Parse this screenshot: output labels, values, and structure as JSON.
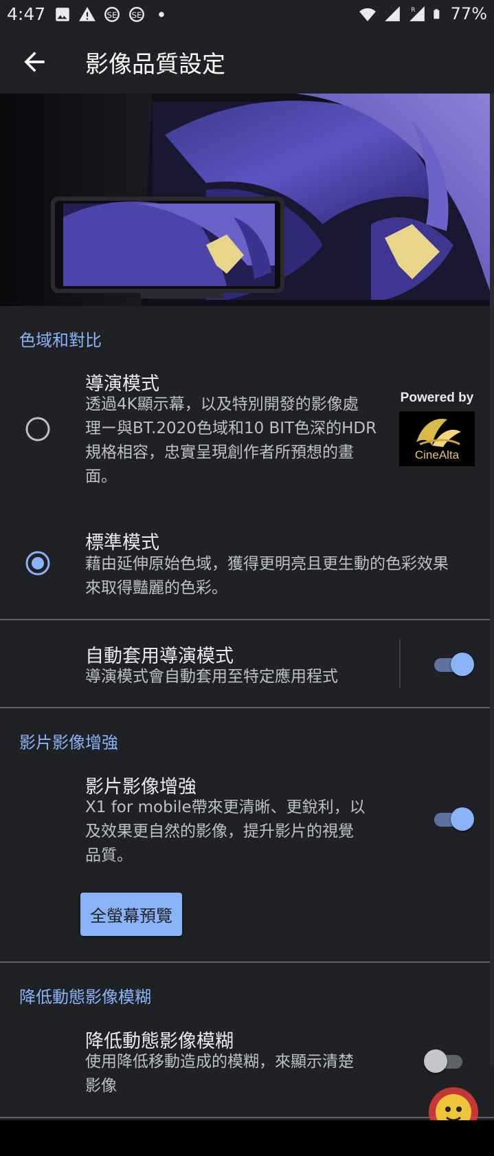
{
  "status_bar": {
    "time": "4:47",
    "battery": "77%",
    "left_icons": [
      "image-icon",
      "alert-icon",
      "sync-icon",
      "sync-icon",
      "dot-icon"
    ],
    "right_icons": [
      "wifi-icon",
      "signal-icon",
      "signal-roaming-icon",
      "battery-icon"
    ]
  },
  "app_bar": {
    "title": "影像品質設定",
    "back_icon": "arrow-back-icon"
  },
  "sections": {
    "color": {
      "header": "色域和對比",
      "director_mode": {
        "title": "導演模式",
        "desc_lines": [
          "透過4K顯示幕，以及特別開發的影像處",
          "理ー與BT.2020色域和10 BIT色深的HDR",
          "規格相容，忠實呈現創作者所預想的畫",
          "面。"
        ],
        "selected": false,
        "badge_top": "Powered by",
        "badge_logo": "CineAlta"
      },
      "standard_mode": {
        "title": "標準模式",
        "desc_lines": [
          "藉由延伸原始色域，獲得更明亮且更生動的色彩效果",
          "來取得豔麗的色彩。"
        ],
        "selected": true
      },
      "auto_director": {
        "title": "自動套用導演模式",
        "desc": "導演模式會自動套用至特定應用程式",
        "enabled": true
      }
    },
    "video_enhance": {
      "header": "影片影像增強",
      "title": "影片影像增強",
      "desc_lines": [
        "X1 for mobile帶來更清晰、更銳利，以",
        "及效果更自然的影像，提升影片的視覺",
        "品質。"
      ],
      "enabled": true,
      "preview_button": "全螢幕預覽"
    },
    "motion_blur": {
      "header": "降低動態影像模糊",
      "title": "降低動態影像模糊",
      "desc_lines": [
        "使用降低移動造成的模糊，來顯示清楚",
        "影像"
      ],
      "enabled": false
    }
  },
  "colors": {
    "accent": "#8ab4f8",
    "background": "#202124",
    "divider": "#5f6368"
  }
}
